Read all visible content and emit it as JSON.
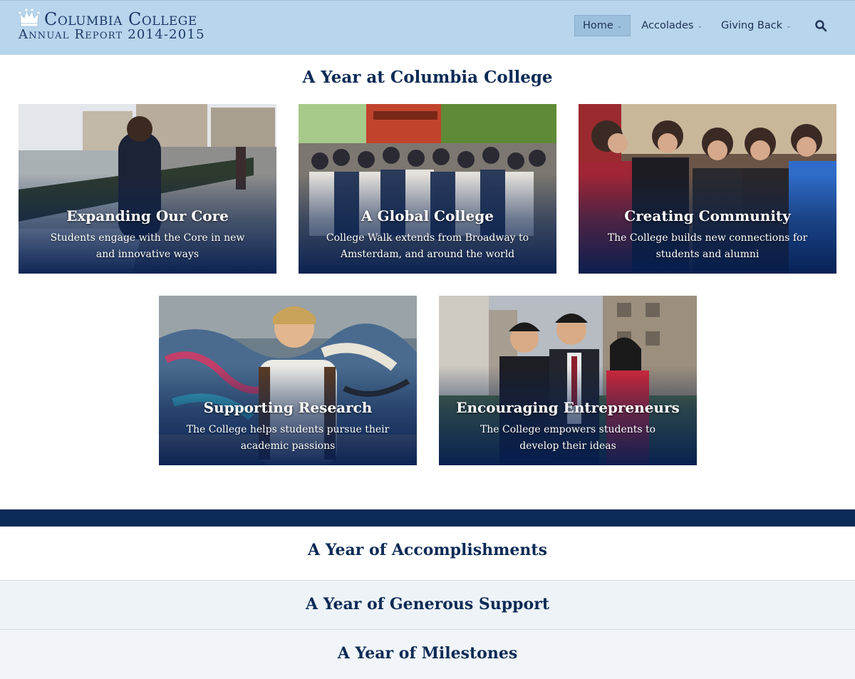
{
  "header": {
    "logo_line1": "Columbia College",
    "logo_line2": "Annual Report 2014-2015",
    "nav": [
      {
        "label": "Home"
      },
      {
        "label": "Accolades"
      },
      {
        "label": "Giving Back"
      }
    ],
    "chevron": "⌄"
  },
  "year_section": {
    "title": "A Year at Columbia College",
    "cards": [
      {
        "title": "Expanding Our Core",
        "desc": "Students engage with the Core in new and innovative ways"
      },
      {
        "title": "A Global College",
        "desc": "College Walk extends from Broadway to Amsterdam, and around the world"
      },
      {
        "title": "Creating Community",
        "desc": "The College builds new connections for students and alumni"
      },
      {
        "title": "Supporting Research",
        "desc": "The College helps students pursue their academic passions"
      },
      {
        "title": "Encouraging Entrepreneurs",
        "desc": "The College empowers students to develop their ideas"
      }
    ]
  },
  "bands": {
    "accomplishments": "A Year of Accomplishments",
    "support": "A Year of Generous Support",
    "milestones": "A Year of Milestones"
  },
  "colors": {
    "header_bg": "#b7d5ec",
    "navy": "#0d2b57",
    "title": "#0b2a55"
  }
}
